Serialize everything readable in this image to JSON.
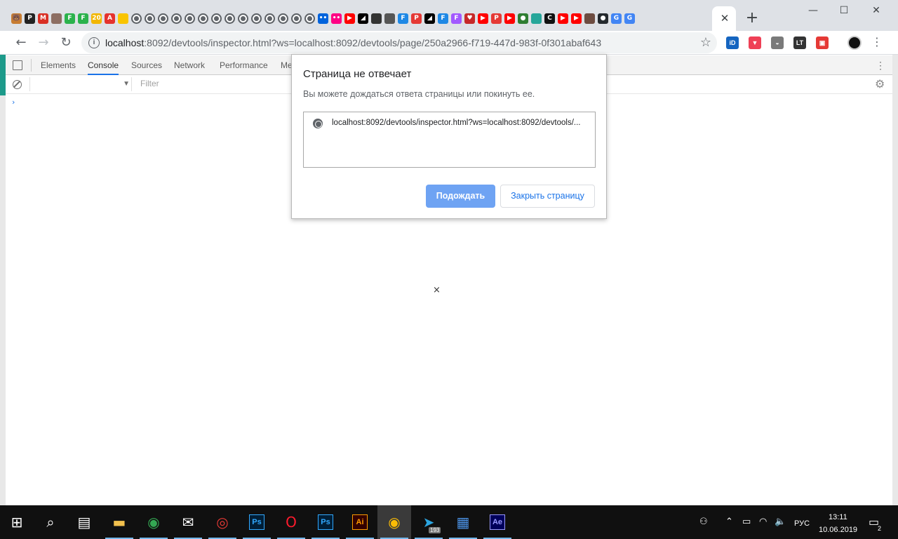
{
  "browser": {
    "tab_close_glyph": "✕",
    "new_tab_glyph": "+",
    "window_controls": [
      "—",
      "☐",
      "✕"
    ],
    "pinned_tabs": [
      {
        "name": "fox-tab-icon",
        "color": "#c77c32",
        "text": "🐻"
      },
      {
        "name": "p-tab-icon",
        "color": "#222222",
        "text": "P"
      },
      {
        "name": "gmail-tab-icon",
        "color": "#d93025",
        "text": "M"
      },
      {
        "name": "book-tab-icon",
        "color": "#8d6e63",
        "text": ""
      },
      {
        "name": "feedly-tab-icon-1",
        "color": "#2bb24c",
        "text": "F"
      },
      {
        "name": "feedly-tab-icon-2",
        "color": "#2bb24c",
        "text": "F"
      },
      {
        "name": "number-tab-icon",
        "color": "#f2b600",
        "text": "20"
      },
      {
        "name": "adobe-tab-icon",
        "color": "#e5322d",
        "text": "A"
      },
      {
        "name": "bulb-tab-icon",
        "color": "#f9c400",
        "text": ""
      },
      {
        "name": "globe-tab-icon",
        "color": "#5f6368",
        "text": "",
        "globe": true
      },
      {
        "name": "globe-tab-icon",
        "color": "#5f6368",
        "text": "",
        "globe": true
      },
      {
        "name": "globe-tab-icon",
        "color": "#5f6368",
        "text": "",
        "globe": true
      },
      {
        "name": "globe-tab-icon",
        "color": "#5f6368",
        "text": "",
        "globe": true
      },
      {
        "name": "globe-tab-icon",
        "color": "#5f6368",
        "text": "",
        "globe": true
      },
      {
        "name": "globe-tab-icon",
        "color": "#5f6368",
        "text": "",
        "globe": true
      },
      {
        "name": "globe-tab-icon",
        "color": "#5f6368",
        "text": "",
        "globe": true
      },
      {
        "name": "globe-tab-icon",
        "color": "#5f6368",
        "text": "",
        "globe": true
      },
      {
        "name": "globe-tab-icon",
        "color": "#5f6368",
        "text": "",
        "globe": true
      },
      {
        "name": "globe-tab-icon",
        "color": "#5f6368",
        "text": "",
        "globe": true
      },
      {
        "name": "globe-tab-icon",
        "color": "#5f6368",
        "text": "",
        "globe": true
      },
      {
        "name": "globe-tab-icon",
        "color": "#5f6368",
        "text": "",
        "globe": true
      },
      {
        "name": "globe-tab-icon",
        "color": "#5f6368",
        "text": "",
        "globe": true
      },
      {
        "name": "globe-tab-icon",
        "color": "#5f6368",
        "text": "",
        "globe": true
      },
      {
        "name": "flickr-tab-icon-1",
        "color": "#0063dc",
        "text": "••"
      },
      {
        "name": "flickr-tab-icon-2",
        "color": "#ff0084",
        "text": "••"
      },
      {
        "name": "youtube-tab-icon",
        "color": "#ff0000",
        "text": "▶"
      },
      {
        "name": "triangle-tab-icon",
        "color": "#000000",
        "text": "◢"
      },
      {
        "name": "square-tab-icon",
        "color": "#333333",
        "text": ""
      },
      {
        "name": "apple-tab-icon",
        "color": "#555555",
        "text": ""
      },
      {
        "name": "figma-tab-icon-1",
        "color": "#1e88e5",
        "text": "F"
      },
      {
        "name": "p-red-tab-icon",
        "color": "#e53935",
        "text": "P"
      },
      {
        "name": "triangle-tab-icon-2",
        "color": "#000000",
        "text": "◢"
      },
      {
        "name": "figma-tab-icon-2",
        "color": "#1e88e5",
        "text": "F"
      },
      {
        "name": "figma-tab-icon-3",
        "color": "#a259ff",
        "text": "F"
      },
      {
        "name": "heart-tab-icon",
        "color": "#c62828",
        "text": "♥"
      },
      {
        "name": "youtube-tab-icon-2",
        "color": "#ff0000",
        "text": "▶"
      },
      {
        "name": "p-red-tab-icon-2",
        "color": "#e53935",
        "text": "P"
      },
      {
        "name": "youtube-tab-icon-3",
        "color": "#ff0000",
        "text": "▶"
      },
      {
        "name": "dot-tab-icon",
        "color": "#2e7d32",
        "text": "●"
      },
      {
        "name": "teal-tab-icon",
        "color": "#26a69a",
        "text": ""
      },
      {
        "name": "c-tab-icon",
        "color": "#111111",
        "text": "C"
      },
      {
        "name": "youtube-tab-icon-4",
        "color": "#ff0000",
        "text": "▶"
      },
      {
        "name": "youtube-tab-icon-5",
        "color": "#ff0000",
        "text": "▶"
      },
      {
        "name": "book-tab-icon-2",
        "color": "#6d4c41",
        "text": ""
      },
      {
        "name": "github-tab-icon",
        "color": "#24292e",
        "text": "●"
      },
      {
        "name": "google-tab-icon-1",
        "color": "#4285f4",
        "text": "G"
      },
      {
        "name": "google-tab-icon-2",
        "color": "#4285f4",
        "text": "G"
      }
    ],
    "url": {
      "host": "localhost",
      "rest": ":8092/devtools/inspector.html?ws=localhost:8092/devtools/page/250a2966-f719-447d-983f-0f301abaf643"
    },
    "extensions": [
      {
        "name": "id-extension-icon",
        "color": "#1565c0",
        "text": "iD"
      },
      {
        "name": "pocket-extension-icon",
        "color": "#ef4056",
        "text": "▼"
      },
      {
        "name": "incognito-extension-icon",
        "color": "#7a7a7a",
        "text": "◒"
      },
      {
        "name": "lt-extension-icon",
        "color": "#333333",
        "text": "LT"
      },
      {
        "name": "calendar-extension-icon",
        "color": "#e53935",
        "text": "▣"
      }
    ]
  },
  "devtools": {
    "tabs": [
      "Elements",
      "Console",
      "Sources",
      "Network",
      "Performance",
      "Me"
    ],
    "active_tab": "Console",
    "filter_placeholder": "Filter",
    "prompt_glyph": "›",
    "loading_glyph": "×",
    "accent_color": "#1a73e8"
  },
  "dialog": {
    "title": "Страница не отвечает",
    "message": "Вы можете дождаться ответа страницы или покинуть ее.",
    "page_url": "localhost:8092/devtools/inspector.html?ws=localhost:8092/devtools/...",
    "wait_button": "Подождать",
    "close_button": "Закрыть страницу"
  },
  "taskbar": {
    "apps": [
      {
        "name": "start-button",
        "glyph": "⊞",
        "color": "#ffffff"
      },
      {
        "name": "search-button",
        "glyph": "⌕",
        "color": "#ffffff"
      },
      {
        "name": "task-view-button",
        "glyph": "▤",
        "color": "#ffffff"
      },
      {
        "name": "file-explorer-app",
        "glyph": "▬",
        "color": "#f2c14e"
      },
      {
        "name": "chrome-app-1",
        "glyph": "◉",
        "color": "#34a853"
      },
      {
        "name": "mail-app",
        "glyph": "✉",
        "color": "#ffffff"
      },
      {
        "name": "creative-cloud-app",
        "glyph": "◎",
        "color": "#e53935"
      },
      {
        "name": "photoshop-app-1",
        "text": "Ps",
        "color": "#31a8ff",
        "bg": "#001e36"
      },
      {
        "name": "opera-app",
        "glyph": "O",
        "color": "#ff1b2d"
      },
      {
        "name": "photoshop-app-2",
        "text": "Ps",
        "color": "#31a8ff",
        "bg": "#001e36"
      },
      {
        "name": "illustrator-app",
        "text": "Ai",
        "color": "#ff9a00",
        "bg": "#330000"
      },
      {
        "name": "chrome-app-2",
        "glyph": "◉",
        "color": "#fbbc05",
        "active": true
      },
      {
        "name": "telegram-app",
        "glyph": "➤",
        "color": "#2ca5e0"
      },
      {
        "name": "cube-app",
        "glyph": "▦",
        "color": "#4a90e2"
      },
      {
        "name": "after-effects-app",
        "text": "Ae",
        "color": "#9999ff",
        "bg": "#00005b"
      }
    ],
    "telegram_badge": "193",
    "lang": "РУС",
    "time": "13:11",
    "date": "10.06.2019",
    "notifications": "2"
  }
}
